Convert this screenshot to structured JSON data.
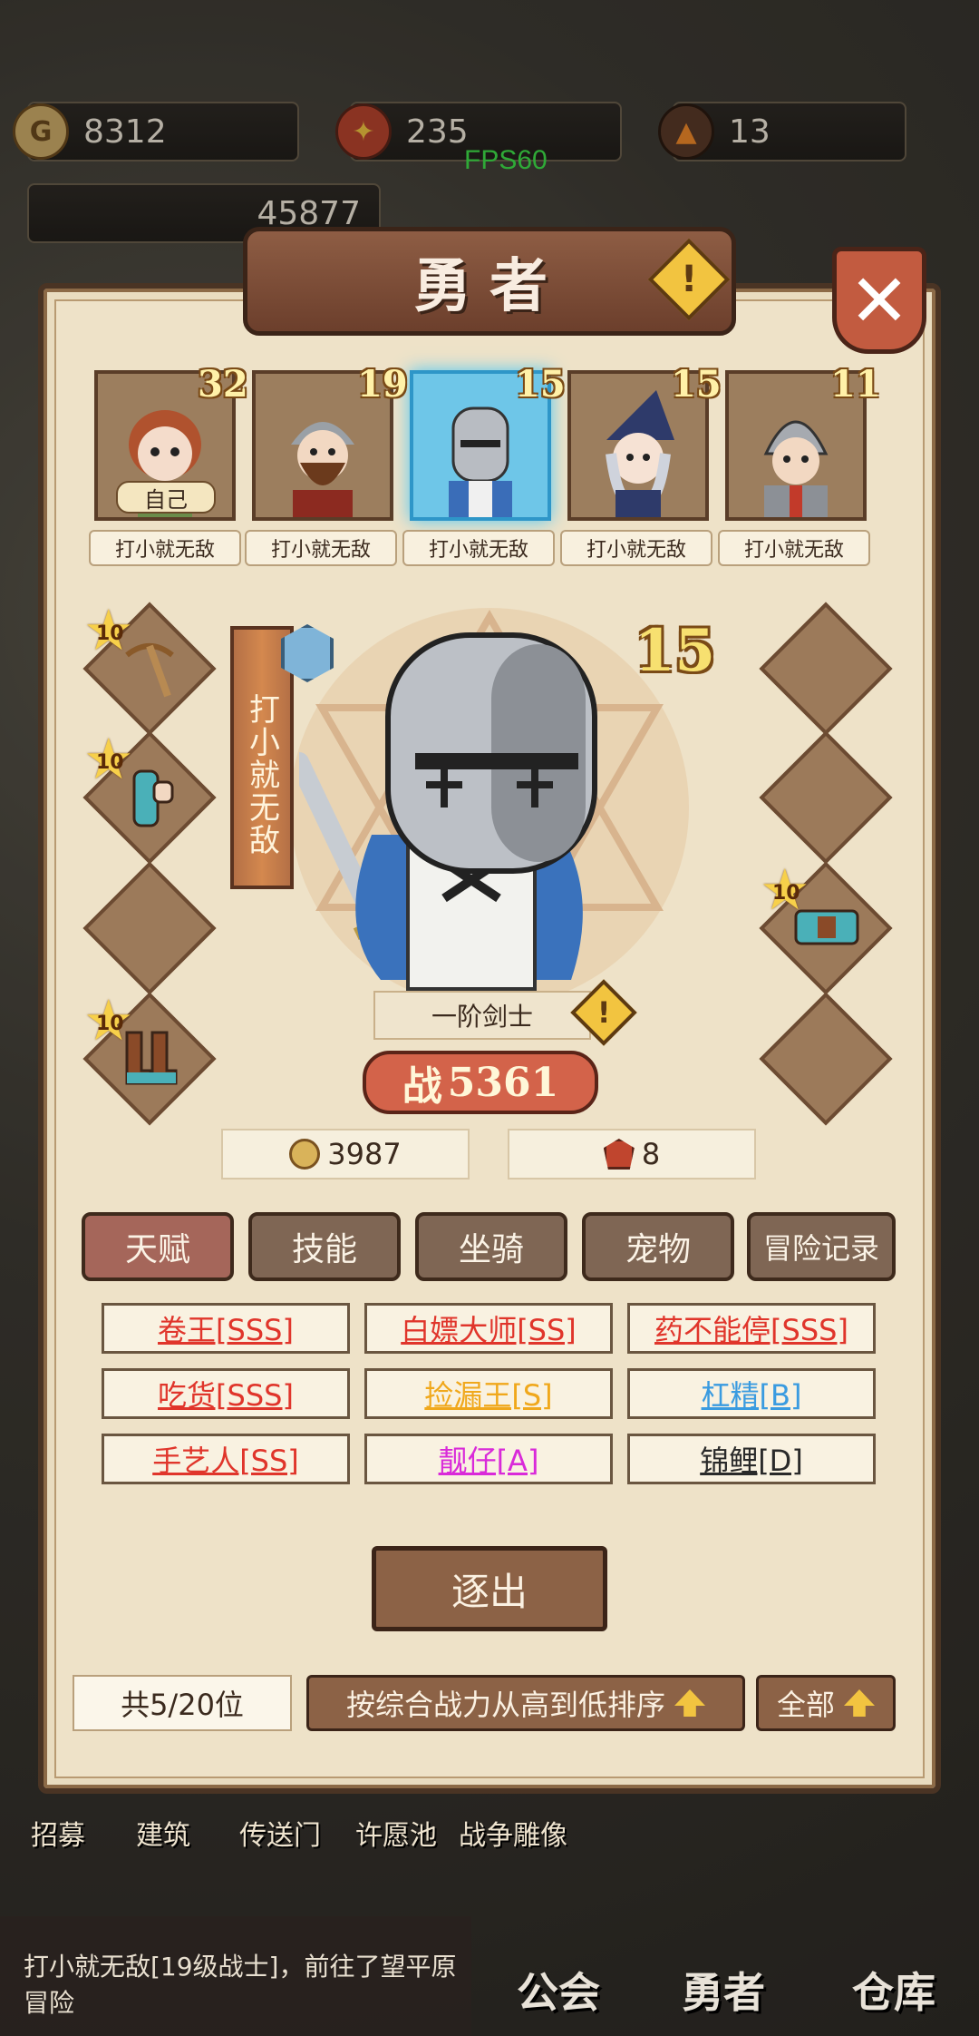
{
  "resources": [
    {
      "icon": "gold-coin-icon",
      "value": "8312"
    },
    {
      "icon": "crest-icon",
      "value": "235"
    },
    {
      "icon": "fire-gem-icon",
      "value": "13"
    }
  ],
  "secondary_value": "45877",
  "fps": "FPS60",
  "title": "勇者",
  "heroes": [
    {
      "level": "32",
      "name": "打小就无敌",
      "tag": "自己",
      "selected": false
    },
    {
      "level": "19",
      "name": "打小就无敌",
      "selected": false
    },
    {
      "level": "15",
      "name": "打小就无敌",
      "selected": true
    },
    {
      "level": "15",
      "name": "打小就无敌",
      "selected": false
    },
    {
      "level": "11",
      "name": "打小就无敌",
      "selected": false
    }
  ],
  "equipment": {
    "left": [
      {
        "item": "crossbow-icon",
        "stars": "10"
      },
      {
        "item": "gauntlet-icon",
        "stars": "10"
      },
      {
        "item": "",
        "stars": ""
      },
      {
        "item": "boots-icon",
        "stars": "10"
      }
    ],
    "right": [
      {
        "item": "",
        "stars": ""
      },
      {
        "item": "",
        "stars": ""
      },
      {
        "item": "belt-icon",
        "stars": "10"
      },
      {
        "item": "",
        "stars": ""
      }
    ]
  },
  "selected_hero": {
    "banner_name": "打小就无敌",
    "level": "15",
    "class": "一阶剑士",
    "power_prefix": "战",
    "power": "5361",
    "gold": "3987",
    "crest": "8"
  },
  "tabs": [
    "天赋",
    "技能",
    "坐骑",
    "宠物",
    "冒险记录"
  ],
  "talents": [
    {
      "label": "卷王[SSS]",
      "color": "#e0352b"
    },
    {
      "label": "白嫖大师[SS]",
      "color": "#e0352b"
    },
    {
      "label": "药不能停[SSS]",
      "color": "#e0352b"
    },
    {
      "label": "吃货[SSS]",
      "color": "#e0352b"
    },
    {
      "label": "捡漏王[S]",
      "color": "#f0a81c"
    },
    {
      "label": "杠精[B]",
      "color": "#3a9be0"
    },
    {
      "label": "手艺人[SS]",
      "color": "#e0352b"
    },
    {
      "label": "靓仔[A]",
      "color": "#d92ad9"
    },
    {
      "label": "锦鲤[D]",
      "color": "#2a2a2a"
    }
  ],
  "expel_button": "逐出",
  "count_label": "共5/20位",
  "sort_label": "按综合战力从高到低排序",
  "filter_label": "全部",
  "bg_nav": [
    "招募",
    "建筑",
    "传送门",
    "许愿池",
    "战争雕像"
  ],
  "feed_text": "打小就无敌[19级战士]，前往了望平原冒险",
  "bottom_nav": [
    "公会",
    "勇者",
    "仓库"
  ]
}
